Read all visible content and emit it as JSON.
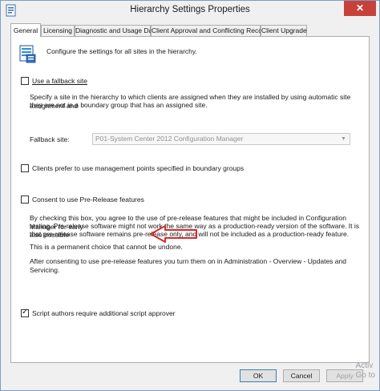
{
  "window": {
    "title": "Hierarchy Settings Properties",
    "close_label": "✕"
  },
  "tabs": [
    {
      "label": "General"
    },
    {
      "label": "Licensing"
    },
    {
      "label": "Diagnostic and Usage Data"
    },
    {
      "label": "Client Approval and Conflicting Records"
    },
    {
      "label": "Client Upgrade"
    }
  ],
  "general": {
    "intro": "Configure the settings for all sites in the hierarchy.",
    "fallback": {
      "checkbox_label": "Use a fallback site",
      "checked": false,
      "description_line1": "Specify a site in the hierarchy to which clients are assigned when they are installed by using automatic site assignment and",
      "description_line2": "they are not in a boundary group that has an assigned site.",
      "site_label": "Fallback site:",
      "site_value": "P01-System Center 2012 Configuration Manager"
    },
    "mgmt_points": {
      "checkbox_label": "Clients prefer to use management points specified in boundary groups",
      "checked": false
    },
    "prerelease": {
      "checkbox_label": "Consent to use Pre-Release features",
      "checked": false,
      "line1": "By checking this box, you agree to the use of pre-release features that might be included in Configuration Manager for early",
      "line2": "testing. Pre-release software might not work the same way as a production-ready version of the software. It is also possible",
      "line3": "that pre-release software remains pre-release only, and will not be included as a production-ready feature.",
      "line4": "This is a permanent choice that cannot be undone.",
      "line5": "After consenting to use pre-release features you turn them on in Administration - Overview - Updates and Servicing."
    },
    "script_approver": {
      "checkbox_label": "Script authors require additional script approver",
      "checked": true
    }
  },
  "buttons": {
    "ok": "OK",
    "cancel": "Cancel",
    "apply": "Apply"
  },
  "watermark": {
    "line1": "Activ",
    "line2": "Go to"
  }
}
